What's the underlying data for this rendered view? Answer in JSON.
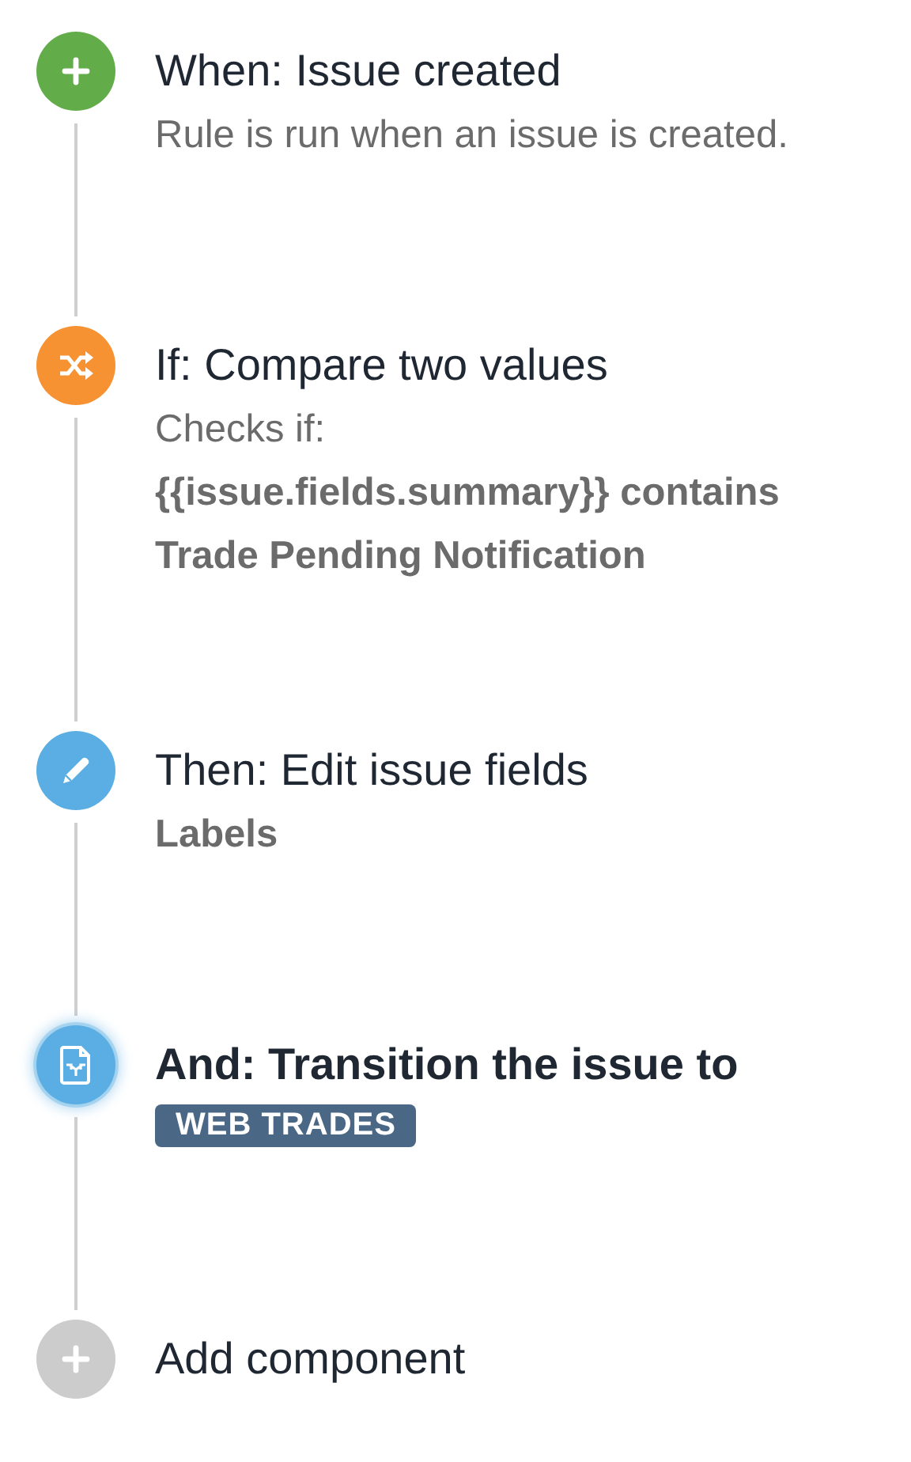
{
  "steps": [
    {
      "kind": "trigger",
      "title": "When: Issue created",
      "selected": false,
      "details": [
        {
          "kind": "plain",
          "text": "Rule is run when an issue is created."
        }
      ]
    },
    {
      "kind": "condition",
      "title": "If: Compare two values",
      "selected": false,
      "details": [
        {
          "kind": "plain",
          "text": "Checks if:"
        },
        {
          "kind": "bold",
          "text": "{{issue.fields.summary}} contains"
        },
        {
          "kind": "bold",
          "text": "Trade Pending Notification"
        }
      ]
    },
    {
      "kind": "edit",
      "title": "Then: Edit issue fields",
      "selected": false,
      "details": [
        {
          "kind": "bold",
          "text": "Labels"
        }
      ]
    },
    {
      "kind": "transition",
      "title": "And: Transition the issue to",
      "selected": true,
      "details": [
        {
          "kind": "tag",
          "text": "WEB TRADES"
        }
      ]
    },
    {
      "kind": "add",
      "title": "Add component",
      "selected": false
    }
  ]
}
